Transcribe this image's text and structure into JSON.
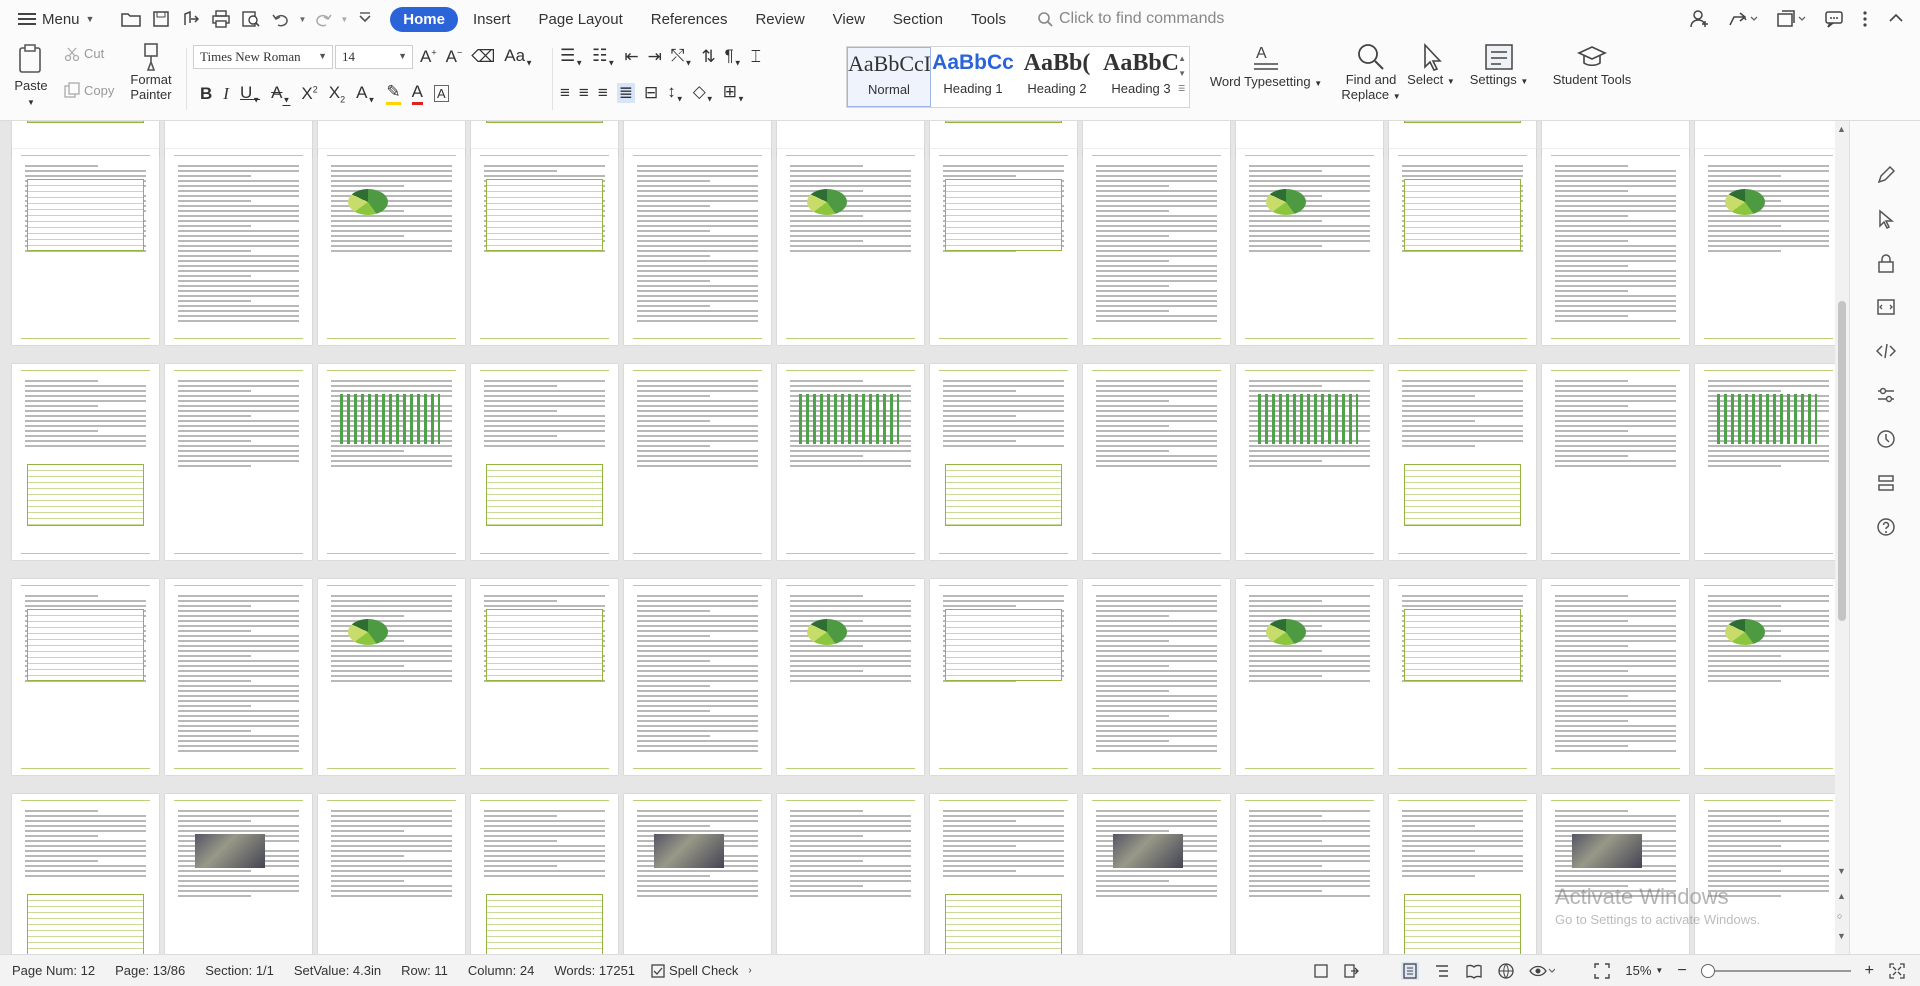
{
  "menu": {
    "label": "Menu"
  },
  "tabs": [
    "Home",
    "Insert",
    "Page Layout",
    "References",
    "Review",
    "View",
    "Section",
    "Tools"
  ],
  "search": {
    "placeholder": "Click to find commands"
  },
  "ribbon": {
    "paste": "Paste",
    "cut": "Cut",
    "copy": "Copy",
    "format_painter_1": "Format",
    "format_painter_2": "Painter",
    "font_name": "Times New Roman",
    "font_size": "14",
    "styles": [
      {
        "sample": "AaBbCcI",
        "name": "Normal"
      },
      {
        "sample": "AaBbCc",
        "name": "Heading 1"
      },
      {
        "sample": "AaBb(",
        "name": "Heading 2"
      },
      {
        "sample": "AaBbC",
        "name": "Heading 3"
      }
    ],
    "word_typesetting": "Word Typesetting",
    "find_replace_1": "Find and",
    "find_replace_2": "Replace",
    "select": "Select",
    "settings": "Settings",
    "student_tools": "Student Tools"
  },
  "status": {
    "page_num": "Page Num: 12",
    "page": "Page: 13/86",
    "section": "Section: 1/1",
    "set_value": "SetValue: 4.3in",
    "row": "Row: 11",
    "column": "Column: 24",
    "words": "Words: 17251",
    "spell_check": "Spell Check",
    "zoom": "15%"
  },
  "watermark": {
    "line1": "Activate Windows",
    "line2": "Go to Settings to activate Windows."
  },
  "colors": {
    "accent": "#2b63d9",
    "page_rule": "#b9cf78",
    "table_green": "#93b441"
  }
}
